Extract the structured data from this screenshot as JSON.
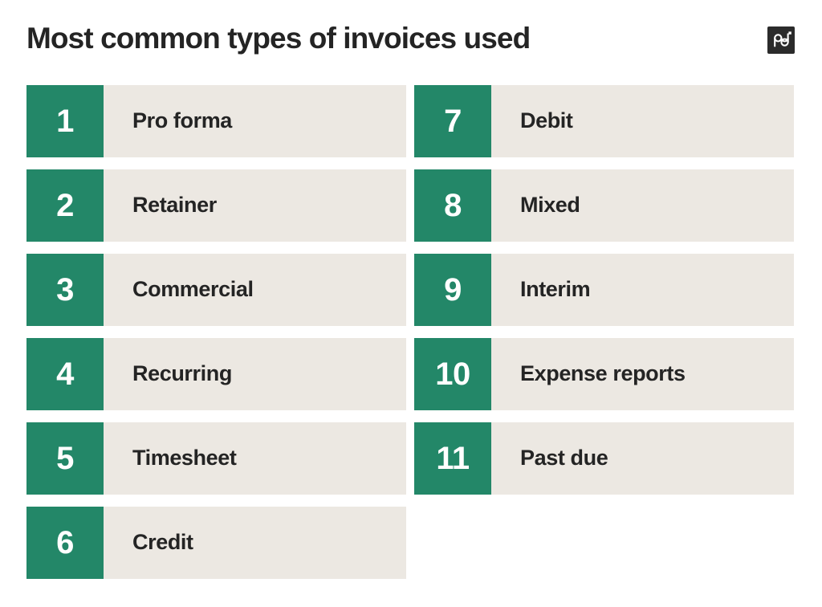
{
  "header": {
    "title": "Most common types of invoices used",
    "logo": {
      "name": "pandadoc-logo",
      "text": "pd"
    }
  },
  "theme": {
    "background": "#ffffff",
    "accent_green": "#238768",
    "row_background": "#ece8e2",
    "text_dark": "#242424",
    "number_text": "#ffffff",
    "logo_background": "#2b2b2b"
  },
  "list": {
    "columns": [
      {
        "name": "left-column",
        "items": [
          {
            "number": "1",
            "label": "Pro forma"
          },
          {
            "number": "2",
            "label": "Retainer"
          },
          {
            "number": "3",
            "label": "Commercial"
          },
          {
            "number": "4",
            "label": "Recurring"
          },
          {
            "number": "5",
            "label": "Timesheet"
          },
          {
            "number": "6",
            "label": "Credit"
          }
        ]
      },
      {
        "name": "right-column",
        "items": [
          {
            "number": "7",
            "label": "Debit"
          },
          {
            "number": "8",
            "label": "Mixed"
          },
          {
            "number": "9",
            "label": "Interim"
          },
          {
            "number": "10",
            "label": "Expense reports"
          },
          {
            "number": "11",
            "label": "Past due"
          }
        ]
      }
    ]
  }
}
